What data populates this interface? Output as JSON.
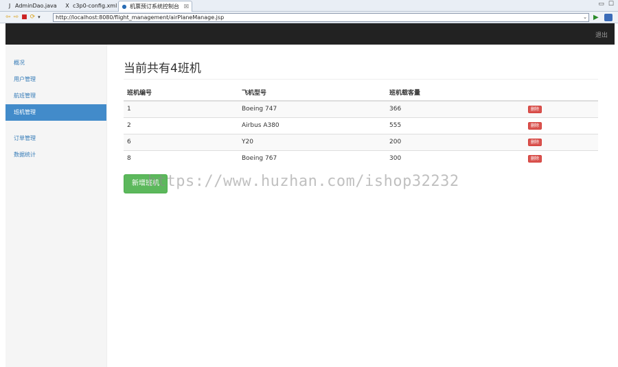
{
  "ide_tabs": [
    {
      "icon": "J",
      "label": "AdminDao.java"
    },
    {
      "icon": "X",
      "label": "c3p0-config.xml"
    },
    {
      "icon": "●",
      "label": "机票预订系统控制台",
      "close": "☒"
    }
  ],
  "address_bar": {
    "url": "http://localhost:8080/flight_management/airPlaneManage.jsp"
  },
  "navbar": {
    "logout_label": "退出"
  },
  "sidebar": {
    "group1": [
      {
        "label": "概况"
      },
      {
        "label": "用户管理"
      },
      {
        "label": "航班管理"
      },
      {
        "label": "班机管理"
      }
    ],
    "group2": [
      {
        "label": "订单管理"
      },
      {
        "label": "数据统计"
      }
    ]
  },
  "main": {
    "title": "当前共有4班机",
    "table": {
      "headers": [
        "班机编号",
        "飞机型号",
        "班机载客量"
      ],
      "rows": [
        {
          "id": "1",
          "model": "Boeing 747",
          "capacity": "366",
          "action": "删除"
        },
        {
          "id": "2",
          "model": "Airbus A380",
          "capacity": "555",
          "action": "删除"
        },
        {
          "id": "6",
          "model": "Y20",
          "capacity": "200",
          "action": "删除"
        },
        {
          "id": "8",
          "model": "Boeing 767",
          "capacity": "300",
          "action": "删除"
        }
      ]
    },
    "add_button_label": "新增班机"
  },
  "watermark": "https://www.huzhan.com/ishop32232",
  "colors": {
    "navbar": "#222222",
    "sidebar_active": "#428bca",
    "delete_button": "#d9534f",
    "add_button": "#5cb85c"
  }
}
